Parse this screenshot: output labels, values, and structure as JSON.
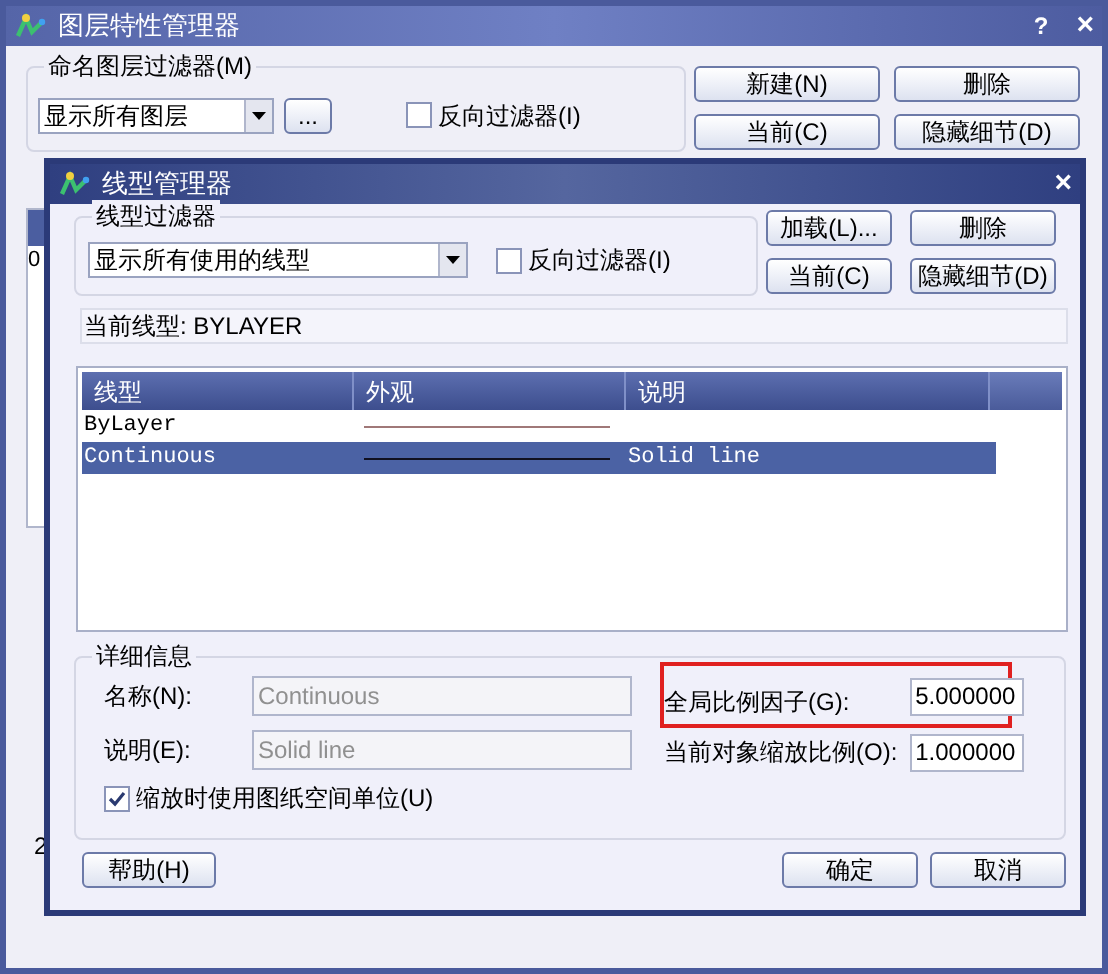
{
  "back_window": {
    "title": "图层特性管理器",
    "help": "?",
    "close": "×",
    "filter_group": {
      "label": "命名图层过滤器(M)",
      "select": "显示所有图层",
      "browse": "...",
      "invert": {
        "label": "反向过滤器(I)",
        "checked": false
      }
    },
    "buttons": [
      "新建(N)",
      "删除",
      "当前(C)",
      "隐藏细节(D)"
    ],
    "list_fragment": "0",
    "status_fragment": "2"
  },
  "dialog": {
    "title": "线型管理器",
    "close": "×",
    "filter_group": {
      "label": "线型过滤器",
      "select": "显示所有使用的线型",
      "invert": {
        "label": "反向过滤器(I)",
        "checked": false
      }
    },
    "buttons": [
      "加载(L)...",
      "删除",
      "当前(C)",
      "隐藏细节(D)"
    ],
    "current_linetype": "当前线型: BYLAYER",
    "table": {
      "columns": [
        "线型",
        "外观",
        "说明"
      ],
      "rows": [
        {
          "linetype": "ByLayer",
          "selected": false
        },
        {
          "linetype": "Continuous",
          "description": "Solid line",
          "selected": true
        }
      ]
    },
    "details": {
      "label": "详细信息",
      "fields": [
        {
          "label": "名称(N):",
          "value": "Continuous",
          "disabled": true
        },
        {
          "label": "说明(E):",
          "value": "Solid line",
          "disabled": true
        }
      ],
      "scale_fields": [
        {
          "label": "全局比例因子(G):",
          "value": "5.000000",
          "highlighted": true
        },
        {
          "label": "当前对象缩放比例(O):",
          "value": "1.000000",
          "highlighted": false
        }
      ],
      "paper_space": {
        "label": "缩放时使用图纸空间单位(U)",
        "checked": true
      }
    },
    "footer_buttons": [
      "帮助(H)",
      "确定",
      "取消"
    ]
  }
}
